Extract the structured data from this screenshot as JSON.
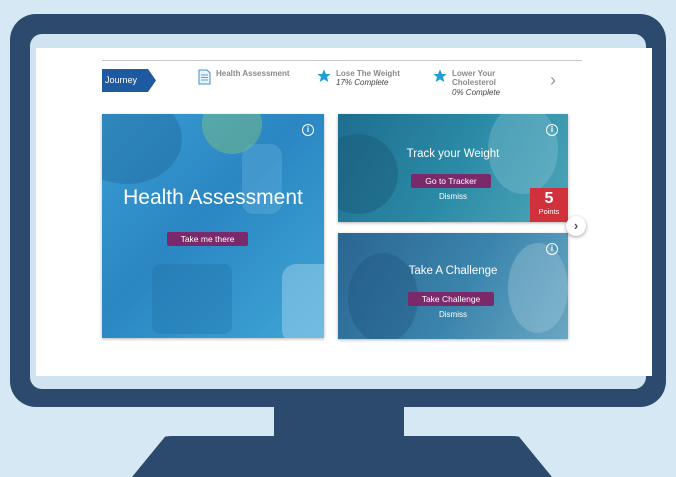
{
  "journey": {
    "tag_label": "Journey",
    "steps": [
      {
        "title": "Health Assessment",
        "subtitle": "",
        "icon": "document-icon"
      },
      {
        "title": "Lose The Weight",
        "subtitle": "17% Complete",
        "icon": "star-icon"
      },
      {
        "title": "Lower Your Cholesterol",
        "title_line1": "Lower Your",
        "title_line2": "Cholesterol",
        "subtitle": "0% Complete",
        "icon": "star-icon"
      }
    ],
    "next_icon": "chevron-right-icon"
  },
  "cards": {
    "health_assessment": {
      "title": "Health Assessment",
      "button": "Take me there"
    },
    "track_weight": {
      "title": "Track your Weight",
      "button": "Go to Tracker",
      "dismiss": "Dismiss",
      "points_value": "5",
      "points_label": "Points"
    },
    "challenge": {
      "title": "Take A Challenge",
      "button": "Take Challenge",
      "dismiss": "Dismiss"
    }
  },
  "colors": {
    "accent_blue": "#1e5aa0",
    "button_purple": "#7a2a6b",
    "points_red": "#d0313b",
    "star": "#1ea0d6"
  }
}
